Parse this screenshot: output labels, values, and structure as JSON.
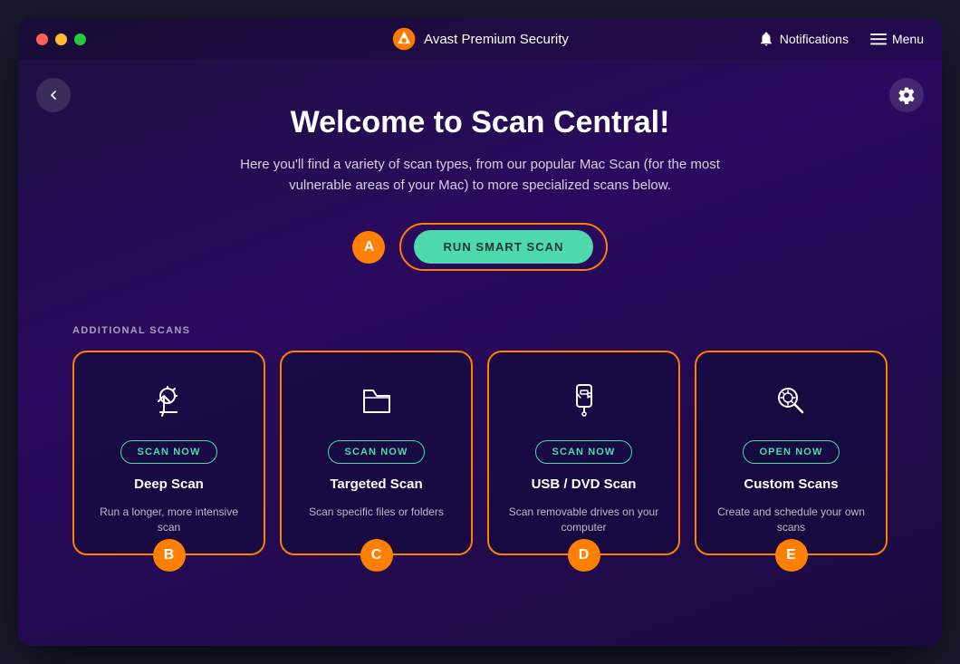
{
  "app": {
    "title": "Avast Premium Security"
  },
  "titlebar": {
    "notifications_label": "Notifications",
    "menu_label": "Menu"
  },
  "hero": {
    "title": "Welcome to Scan Central!",
    "subtitle": "Here you'll find a variety of scan types, from our popular Mac Scan (for the most vulnerable areas of your Mac) to more specialized scans below.",
    "smart_scan_label": "RUN SMART SCAN",
    "badge_a": "A"
  },
  "additional": {
    "section_label": "ADDITIONAL SCANS",
    "cards": [
      {
        "id": "deep-scan",
        "icon": "microscope",
        "btn_label": "SCAN NOW",
        "title": "Deep Scan",
        "desc": "Run a longer, more intensive scan",
        "badge": "B"
      },
      {
        "id": "targeted-scan",
        "icon": "folder",
        "btn_label": "SCAN NOW",
        "title": "Targeted Scan",
        "desc": "Scan specific files or folders",
        "badge": "C"
      },
      {
        "id": "usb-dvd-scan",
        "icon": "usb",
        "btn_label": "SCAN NOW",
        "title": "USB / DVD Scan",
        "desc": "Scan removable drives on your computer",
        "badge": "D"
      },
      {
        "id": "custom-scans",
        "icon": "gear-search",
        "btn_label": "OPEN NOW",
        "title": "Custom Scans",
        "desc": "Create and schedule your own scans",
        "badge": "E"
      }
    ]
  },
  "colors": {
    "orange": "#ff7f00",
    "teal": "#4dd9ac",
    "white": "#ffffff"
  }
}
